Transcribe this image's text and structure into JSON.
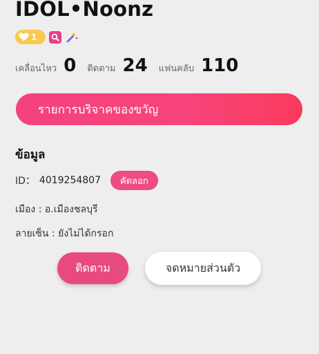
{
  "profile": {
    "username": "IDOL•Noonz",
    "level": "1"
  },
  "badges": {
    "level_icon": "heart-icon",
    "search_icon": "search-icon",
    "wand_icon": "magic-wand-icon"
  },
  "stats": {
    "moments_label": "เคลื่อนไหว",
    "moments_value": "0",
    "following_label": "ติดตาม",
    "following_value": "24",
    "fans_label": "แฟนคลับ",
    "fans_value": "110"
  },
  "donation": {
    "label": "รายการบริจาคของขวัญ"
  },
  "info": {
    "title": "ข้อมูล",
    "id_label": "ID：",
    "id_value": "4019254807",
    "copy_label": "คัดลอก",
    "city": "เมือง : อ.เมืองชลบุรี",
    "signature": "ลายเซ็น : ยังไม่ได้กรอก"
  },
  "actions": {
    "follow_label": "ติดตาม",
    "message_label": "จดหมายส่วนตัว"
  },
  "colors": {
    "accent": "#ee4d82",
    "gold": "#f9c94e",
    "background": "#eeeeee"
  }
}
